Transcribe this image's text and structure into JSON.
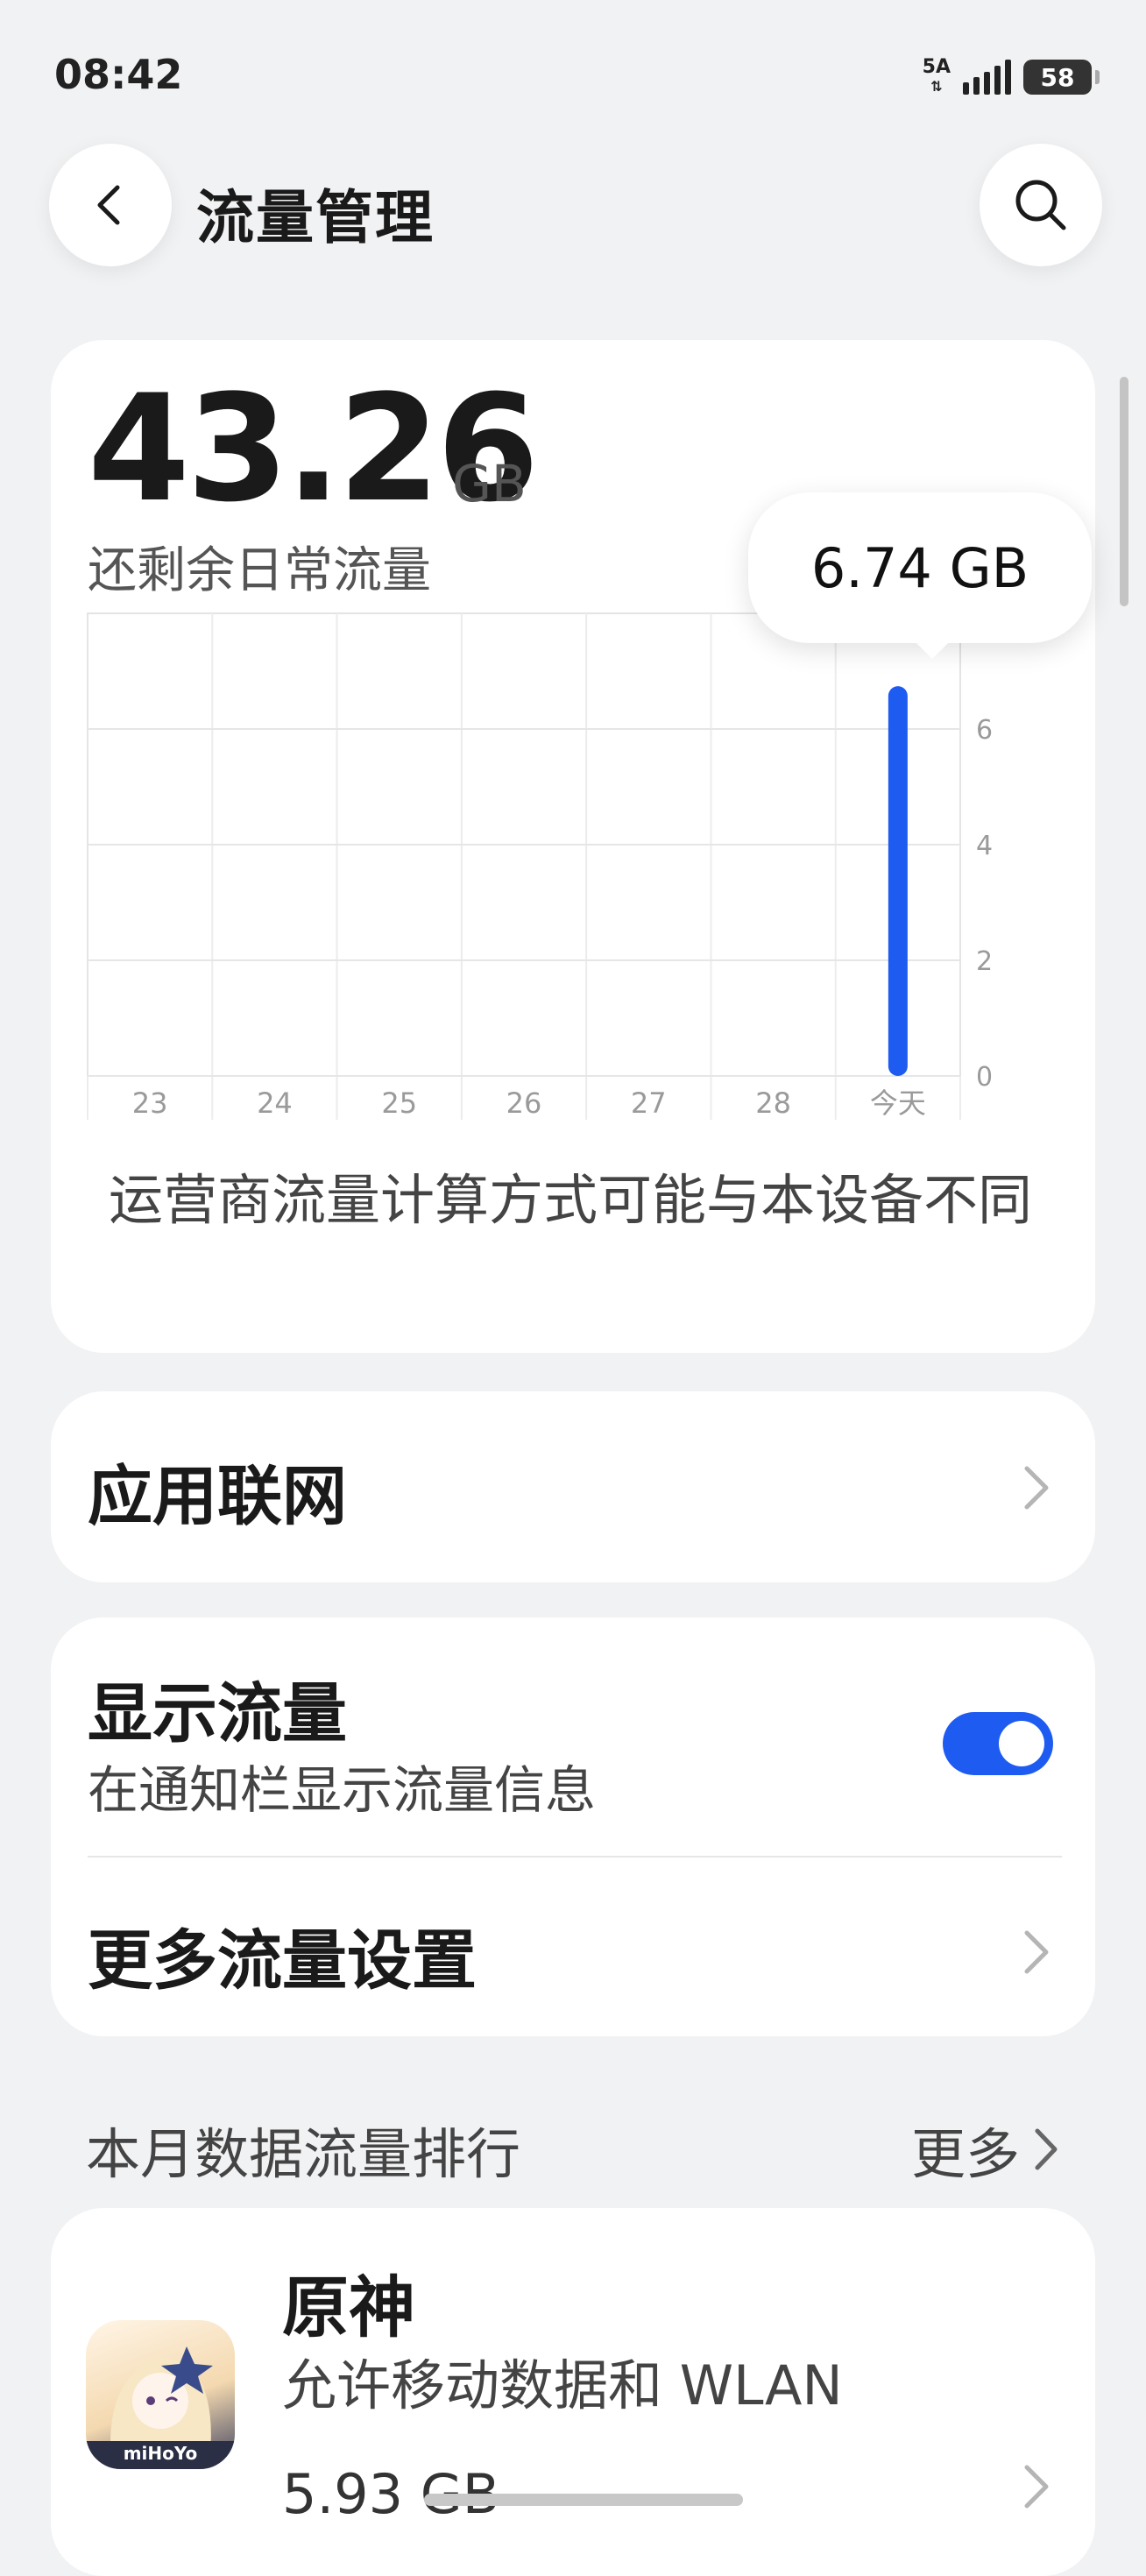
{
  "status_bar": {
    "time": "08:42",
    "network": "5A",
    "battery": "58"
  },
  "header": {
    "title": "流量管理",
    "back_icon": "back-arrow-icon",
    "search_icon": "search-icon"
  },
  "usage": {
    "remaining_value": "43.26",
    "remaining_unit": "GB",
    "remaining_label": "还剩余日常流量",
    "tooltip": "6.74 GB",
    "note": "运营商流量计算方式可能与本设备不同"
  },
  "chart_data": {
    "type": "bar",
    "categories": [
      "23",
      "24",
      "25",
      "26",
      "27",
      "28",
      "今天"
    ],
    "values": [
      0,
      0,
      0,
      0,
      0,
      0,
      6.74
    ],
    "ylim": [
      0,
      8
    ],
    "yticks": [
      "0",
      "2",
      "4",
      "6"
    ],
    "bar_color": "#1e5bf0",
    "grid": true
  },
  "network_row": {
    "label": "应用联网"
  },
  "display_row": {
    "label": "显示流量",
    "sub": "在通知栏显示流量信息",
    "toggle_on": true
  },
  "more_settings": {
    "label": "更多流量设置"
  },
  "ranking": {
    "title": "本月数据流量排行",
    "more": "更多"
  },
  "app": {
    "name": "原神",
    "permission": "允许移动数据和 WLAN",
    "usage": "5.93 GB",
    "icon": "genshin-app-icon",
    "icon_label": "miHoYo"
  },
  "colors": {
    "accent": "#1e5bf0",
    "background": "#f1f2f4",
    "card": "#ffffff"
  }
}
